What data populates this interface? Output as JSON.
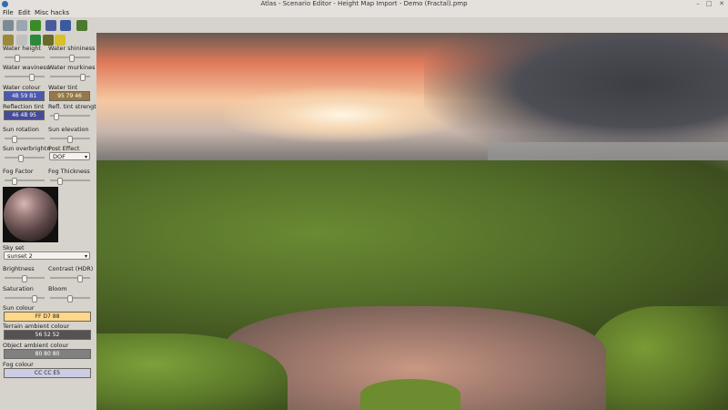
{
  "window": {
    "title": "Atlas - Scenario Editor - Height Map Import - Demo (Fractal).pmp",
    "controls": [
      "–",
      "□",
      "✕"
    ]
  },
  "menu": [
    "File",
    "Edit",
    "Misc hacks"
  ],
  "toolbar": {
    "tools": [
      {
        "name": "select-tool-icon",
        "color": "#7a8a96"
      },
      {
        "name": "move-tool-icon",
        "color": "#9aa6b0"
      },
      {
        "name": "terrain-tool-icon",
        "color": "#3a8a2a"
      },
      {
        "name": "player-tool-icon",
        "color": "#4a5a9a"
      },
      {
        "name": "unit-tool-icon",
        "color": "#3a5aa0"
      },
      {
        "name": "paint-tool-icon",
        "color": "#4a7a2a"
      },
      {
        "name": "map-tool-icon",
        "color": "#9a8a3a"
      },
      {
        "name": "cinema-tool-icon",
        "color": "#c0c0c0"
      },
      {
        "name": "flag-tool-icon",
        "color": "#2a8a3a"
      },
      {
        "name": "figure-tool-icon",
        "color": "#6a6a2a"
      },
      {
        "name": "sun-tool-icon",
        "color": "#d8c02a"
      }
    ]
  },
  "environment": {
    "water_height": "Water height",
    "water_shininess": "Water shininess",
    "water_waviness": "Water waviness",
    "water_murkiness": "Water murkines",
    "water_colour_label": "Water colour",
    "water_colour_value": "4B 59 B1",
    "water_colour_hex": "#4b59b1",
    "water_tint_label": "Water tint",
    "water_tint_value": "95 79 46",
    "water_tint_hex": "#957946",
    "reflection_tint_label": "Reflection tint",
    "reflection_tint_value": "46 4B 95",
    "reflection_tint_hex": "#464b95",
    "refl_tint_strength": "Refl. tint strengt",
    "sun_rotation": "Sun rotation",
    "sun_elevation": "Sun elevation",
    "sun_overbrightness": "Sun overbrightn",
    "post_effect_label": "Post Effect",
    "post_effect_value": "DOF",
    "fog_factor": "Fog Factor",
    "fog_thickness": "Fog Thickness",
    "sky_set_label": "Sky set",
    "sky_set_value": "sunset 2",
    "brightness": "Brightness",
    "contrast": "Contrast (HDR)",
    "saturation": "Saturation",
    "bloom": "Bloom",
    "sun_colour_label": "Sun colour",
    "sun_colour_value": "FF D7 88",
    "sun_colour_hex": "#ffd788",
    "terrain_ambient_label": "Terrain ambient colour",
    "terrain_ambient_value": "56 52 52",
    "terrain_ambient_hex": "#565252",
    "object_ambient_label": "Object ambient colour",
    "object_ambient_value": "80 80 80",
    "object_ambient_hex": "#808080",
    "fog_colour_label": "Fog colour",
    "fog_colour_value": "CC CC E5",
    "fog_colour_hex": "#ccccE5"
  },
  "sliders": {
    "water_height": 0.3,
    "water_shininess": 0.55,
    "water_waviness": 0.7,
    "water_murkiness": 0.88,
    "refl_tint_strength": 0.1,
    "sun_rotation": 0.2,
    "sun_elevation": 0.5,
    "sun_overbrightness": 0.4,
    "fog_factor": 0.2,
    "fog_thickness": 0.2,
    "brightness": 0.5,
    "contrast": 0.78,
    "saturation": 0.8,
    "bloom": 0.5
  }
}
